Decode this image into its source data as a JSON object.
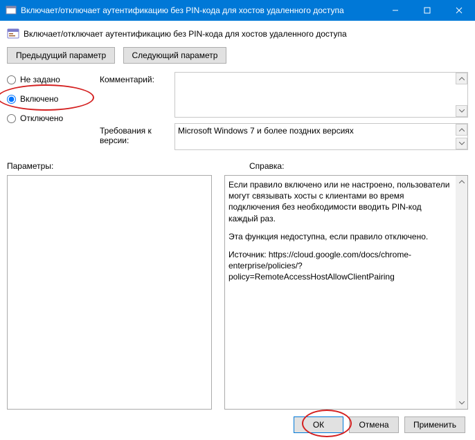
{
  "titlebar": {
    "title": "Включает/отключает аутентификацию без PIN-кода для хостов удаленного доступа"
  },
  "header": {
    "text": "Включает/отключает аутентификацию без PIN-кода для хостов удаленного доступа"
  },
  "nav": {
    "prev": "Предыдущий параметр",
    "next": "Следующий параметр"
  },
  "radios": {
    "not_configured": "Не задано",
    "enabled": "Включено",
    "disabled": "Отключено",
    "selected": "enabled"
  },
  "fields": {
    "comment_label": "Комментарий:",
    "comment_value": "",
    "version_label": "Требования к версии:",
    "version_value": "Microsoft Windows 7 и более поздних версиях"
  },
  "lower": {
    "params_label": "Параметры:",
    "help_label": "Справка:",
    "help_p1": "Если правило включено или не настроено, пользователи могут связывать хосты с клиентами во время подключения без необходимости вводить PIN-код каждый раз.",
    "help_p2": "Эта функция недоступна, если правило отключено.",
    "help_p3": "Источник: https://cloud.google.com/docs/chrome-enterprise/policies/?policy=RemoteAccessHostAllowClientPairing"
  },
  "footer": {
    "ok": "ОК",
    "cancel": "Отмена",
    "apply": "Применить"
  }
}
